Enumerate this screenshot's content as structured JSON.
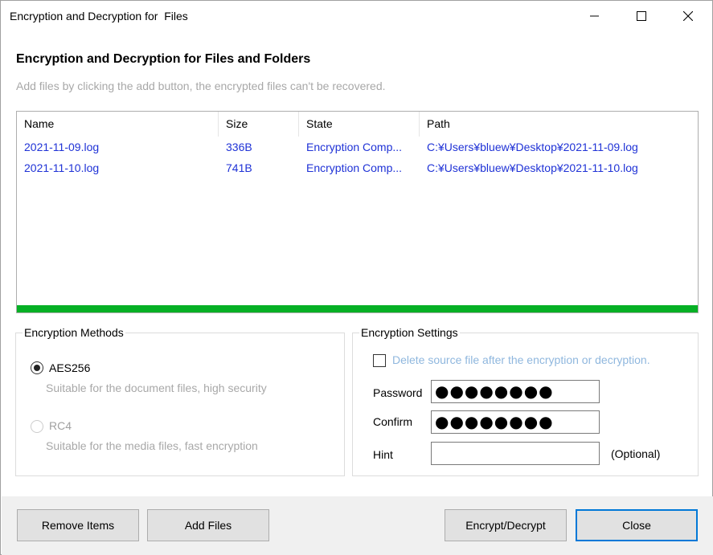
{
  "window": {
    "title": "Encryption and Decryption for  Files",
    "controls": {
      "minimize": "minimize-icon",
      "maximize": "maximize-icon",
      "close": "close-icon"
    }
  },
  "header": {
    "title": "Encryption and Decryption for Files and Folders",
    "subtitle": "Add files by clicking the add button, the encrypted files can't be recovered."
  },
  "file_list": {
    "columns": [
      "Name",
      "Size",
      "State",
      "Path"
    ],
    "rows": [
      {
        "name": "2021-11-09.log",
        "size": "336B",
        "state": "Encryption Comp...",
        "path": "C:¥Users¥bluew¥Desktop¥2021-11-09.log"
      },
      {
        "name": "2021-11-10.log",
        "size": "741B",
        "state": "Encryption Comp...",
        "path": "C:¥Users¥bluew¥Desktop¥2021-11-10.log"
      }
    ],
    "progress_percent": 100,
    "progress_color": "#06b025",
    "row_text_color": "#1f32d6"
  },
  "methods": {
    "label": "Encryption Methods",
    "options": [
      {
        "label": "AES256",
        "description": "Suitable for the document files, high security",
        "selected": true,
        "enabled": true
      },
      {
        "label": "RC4",
        "description": "Suitable for the media files, fast encryption",
        "selected": false,
        "enabled": false
      }
    ]
  },
  "settings": {
    "label": "Encryption Settings",
    "delete_source_label": "Delete source file after the encryption or decryption.",
    "delete_source_checked": false,
    "password_label": "Password",
    "password_value": "●●●●●●●●",
    "confirm_label": "Confirm",
    "confirm_value": "●●●●●●●●",
    "hint_label": "Hint",
    "hint_value": "",
    "hint_optional": "(Optional)"
  },
  "footer": {
    "remove_label": "Remove Items",
    "add_label": "Add Files",
    "encrypt_label": "Encrypt/Decrypt",
    "close_label": "Close"
  }
}
